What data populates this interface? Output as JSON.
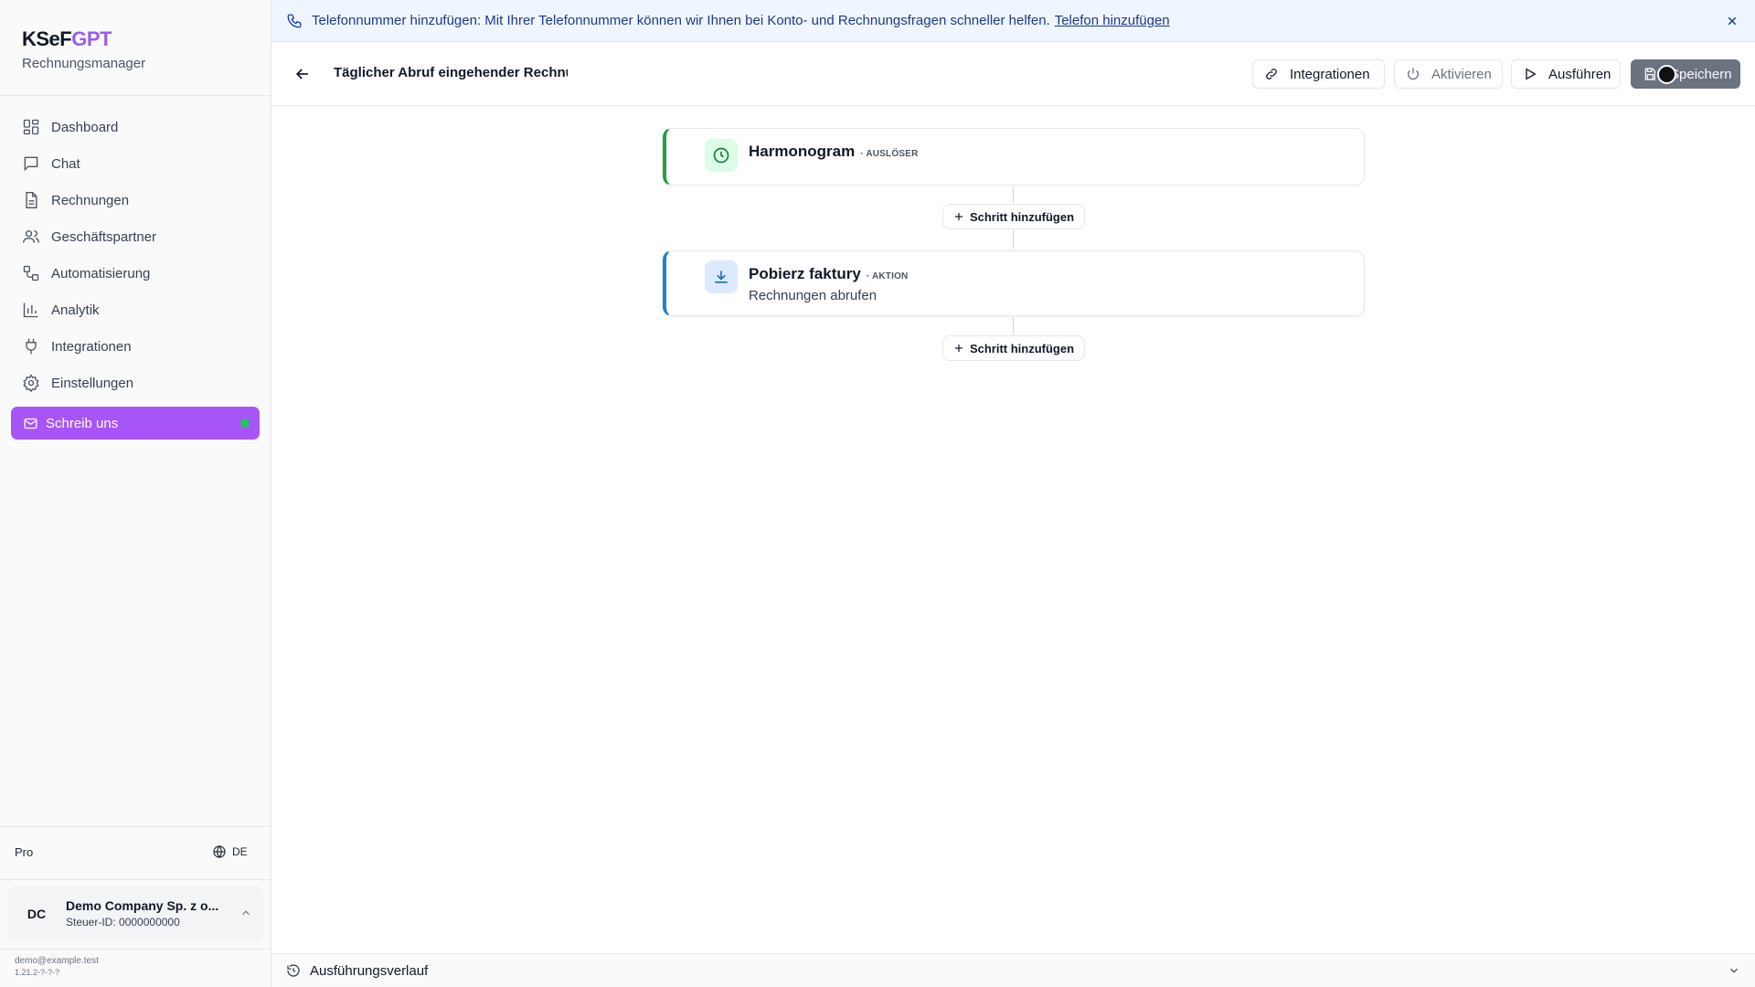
{
  "brand": {
    "part1": "KSeF",
    "part2": "GPT",
    "subtitle": "Rechnungsmanager"
  },
  "sidebar": {
    "items": [
      {
        "label": "Dashboard",
        "icon": "dashboard-icon"
      },
      {
        "label": "Chat",
        "icon": "chat-icon"
      },
      {
        "label": "Rechnungen",
        "icon": "file-icon"
      },
      {
        "label": "Geschäftspartner",
        "icon": "users-icon"
      },
      {
        "label": "Automatisierung",
        "icon": "workflow-icon"
      },
      {
        "label": "Analytik",
        "icon": "bar-chart-icon"
      },
      {
        "label": "Integrationen",
        "icon": "plug-icon"
      },
      {
        "label": "Einstellungen",
        "icon": "gear-icon"
      }
    ],
    "write_us": "Schreib uns",
    "plan": "Pro",
    "language": "DE",
    "company": {
      "initials": "DC",
      "name": "Demo Company Sp. z o...",
      "tax_id": "Steuer-ID: 0000000000"
    },
    "email": "demo@example.test",
    "version": "1.21.2-?-?-?"
  },
  "banner": {
    "text": "Telefonnummer hinzufügen: Mit Ihrer Telefonnummer können wir Ihnen bei Konto- und Rechnungsfragen schneller helfen.",
    "link": "Telefon hinzufügen"
  },
  "header": {
    "title": "Täglicher Abruf eingehender Rechnungen",
    "buttons": {
      "integrations": "Integrationen",
      "activate": "Aktivieren",
      "run": "Ausführen",
      "save": "Speichern"
    }
  },
  "workflow": {
    "trigger": {
      "title": "Harmonogram",
      "tag": "· AUSLÖSER"
    },
    "action": {
      "title": "Pobierz faktury",
      "tag": "· AKTION",
      "subtitle": "Rechnungen abrufen"
    },
    "add_step": "Schritt hinzufügen"
  },
  "history": {
    "title": "Ausführungsverlauf"
  },
  "colors": {
    "accent": "#a855f7",
    "brand_purple": "#9b5cf0",
    "trigger_green": "#22a044",
    "action_blue": "#2284c4",
    "banner_bg": "#eff6ff",
    "online_dot": "#22c55e"
  }
}
